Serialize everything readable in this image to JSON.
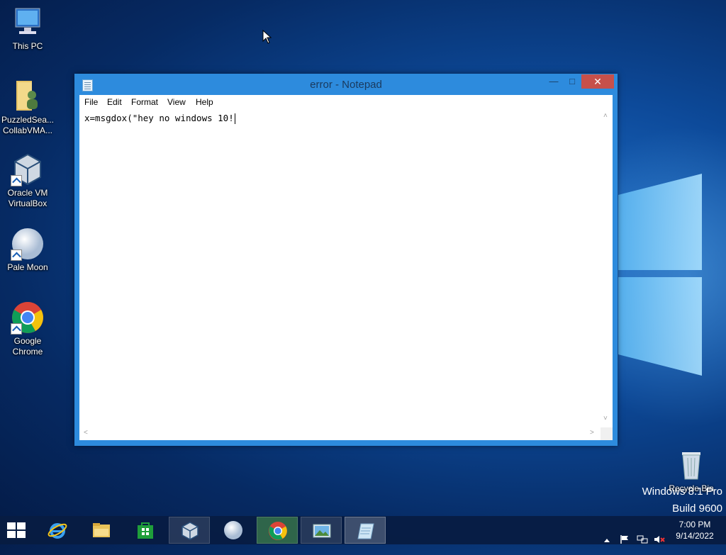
{
  "desktop": {
    "icons": [
      {
        "label": "This PC"
      },
      {
        "label": "PuzzledSea...\nCollabVMA..."
      },
      {
        "label": "Oracle VM\nVirtualBox"
      },
      {
        "label": "Pale Moon"
      },
      {
        "label": "Google\nChrome"
      }
    ],
    "recycle_bin": "Recycle Bin",
    "watermark_line1": "Windows 8.1 Pro",
    "watermark_line2": "Build 9600"
  },
  "notepad": {
    "title": "error - Notepad",
    "menu": [
      "File",
      "Edit",
      "Format",
      "View",
      "Help"
    ],
    "content": "x=msgdox(\"hey no windows 10!"
  },
  "taskbar": {
    "time": "7:00 PM",
    "date": "9/14/2022",
    "apps": [
      "Internet Explorer",
      "File Explorer",
      "Store",
      "Oracle VM VirtualBox",
      "Pale Moon",
      "Google Chrome",
      "Photos",
      "Notepad"
    ]
  },
  "colors": {
    "titlebar": "#2d8bdd",
    "close_button": "#c7504a",
    "taskbar": "#081c42"
  }
}
